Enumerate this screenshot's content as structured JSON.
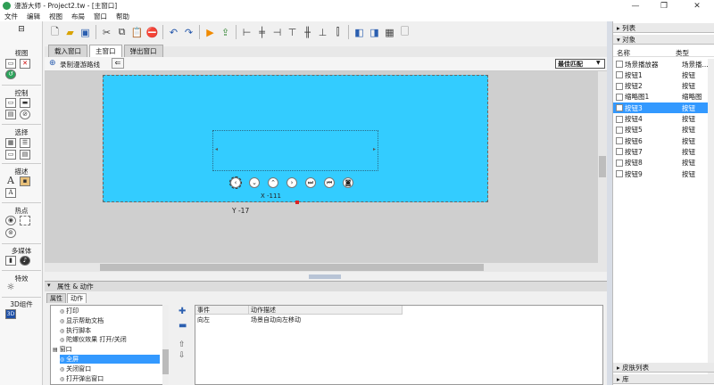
{
  "window": {
    "title": "漫游大师 - Project2.tw - [主窗口]"
  },
  "menu": [
    "文件",
    "编辑",
    "视图",
    "布局",
    "窗口",
    "帮助"
  ],
  "left": {
    "sections": [
      "视图",
      "控制",
      "选择",
      "描述",
      "热点",
      "多媒体",
      "特效",
      "3D组件"
    ],
    "text_icon_label": "A"
  },
  "tabs": [
    "载入窗口",
    "主窗口",
    "弹出窗口"
  ],
  "subbar": {
    "record_label": "录制漫游路线",
    "fit_select": "最佳匹配"
  },
  "canvas": {
    "x_label": "X -111",
    "y_label": "Y -17"
  },
  "right": {
    "list_label": "列表",
    "objects_label": "对象",
    "col_name": "名称",
    "col_type": "类型",
    "objects": [
      {
        "name": "场景播放器",
        "type": "场景播..."
      },
      {
        "name": "按钮1",
        "type": "按钮"
      },
      {
        "name": "按钮2",
        "type": "按钮"
      },
      {
        "name": "缩略图1",
        "type": "缩略图"
      },
      {
        "name": "按钮3",
        "type": "按钮"
      },
      {
        "name": "按钮4",
        "type": "按钮"
      },
      {
        "name": "按钮5",
        "type": "按钮"
      },
      {
        "name": "按钮6",
        "type": "按钮"
      },
      {
        "name": "按钮7",
        "type": "按钮"
      },
      {
        "name": "按钮8",
        "type": "按钮"
      },
      {
        "name": "按钮9",
        "type": "按钮"
      }
    ],
    "skin_label": "皮肤列表",
    "lib_label": "库"
  },
  "props": {
    "title": "属性 & 动作",
    "tab_attr": "属性",
    "tab_action": "动作",
    "tree": [
      "打印",
      "显示帮助文档",
      "执行脚本",
      "陀螺仪效果 打开/关闭",
      "窗口",
      "全屏",
      "关闭窗口",
      "打开弹出窗口"
    ],
    "table_headers": [
      "事件",
      "动作描述"
    ],
    "rows": [
      {
        "event": "向左",
        "desc": "场景自动向左移动"
      }
    ]
  }
}
